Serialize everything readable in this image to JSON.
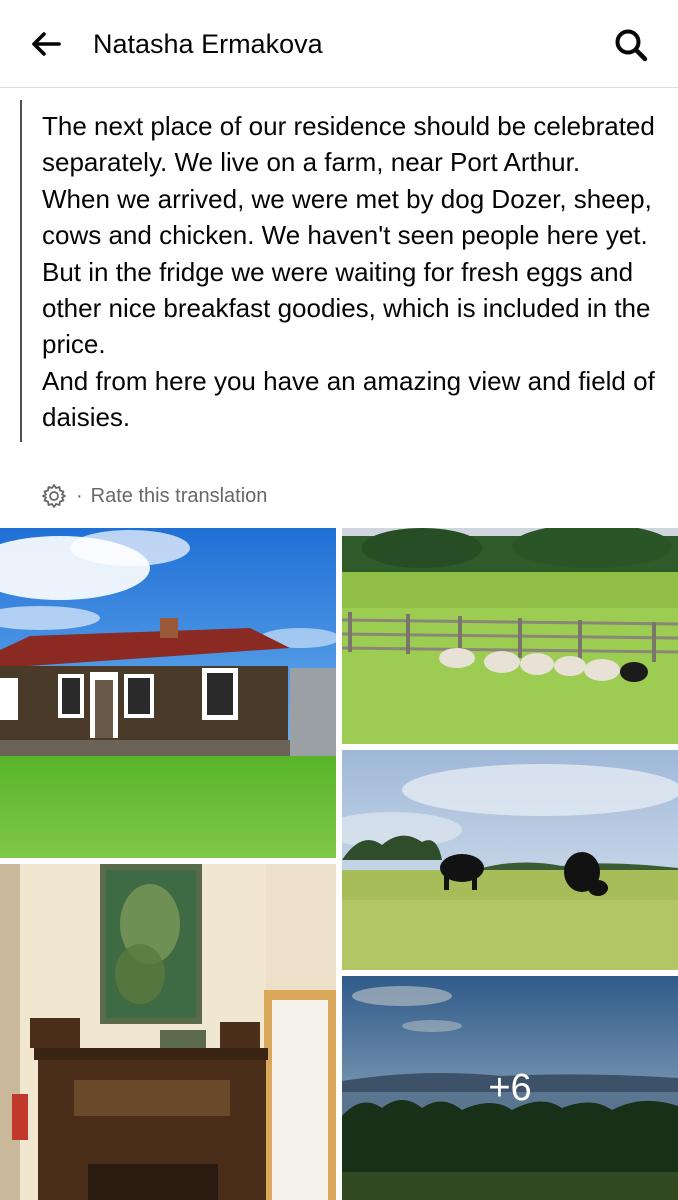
{
  "header": {
    "title": "Natasha Ermakova",
    "back_icon": "arrow-left-icon",
    "search_icon": "search-icon"
  },
  "post": {
    "text": "The next place of our residence should be celebrated separately. We live on a farm, near Port Arthur.\nWhen we arrived, we were met by dog Dozer, sheep, cows and chicken. We haven't seen people here yet. But in the fridge we were waiting for fresh eggs and other nice breakfast goodies, which is included in the price.\nAnd from here you have an amazing view and field of daisies.",
    "rate_dot": "·",
    "rate_label": "Rate this translation",
    "rate_icon": "gear-icon"
  },
  "photos": {
    "more_count": "+6",
    "colors": {
      "sky": "#2f86e0",
      "grass": "#6cbf2e",
      "house_wood": "#4a3a2a",
      "roof": "#8a2a22",
      "wall": "#f1e6cf",
      "fireplace": "#4a2e1a"
    }
  }
}
